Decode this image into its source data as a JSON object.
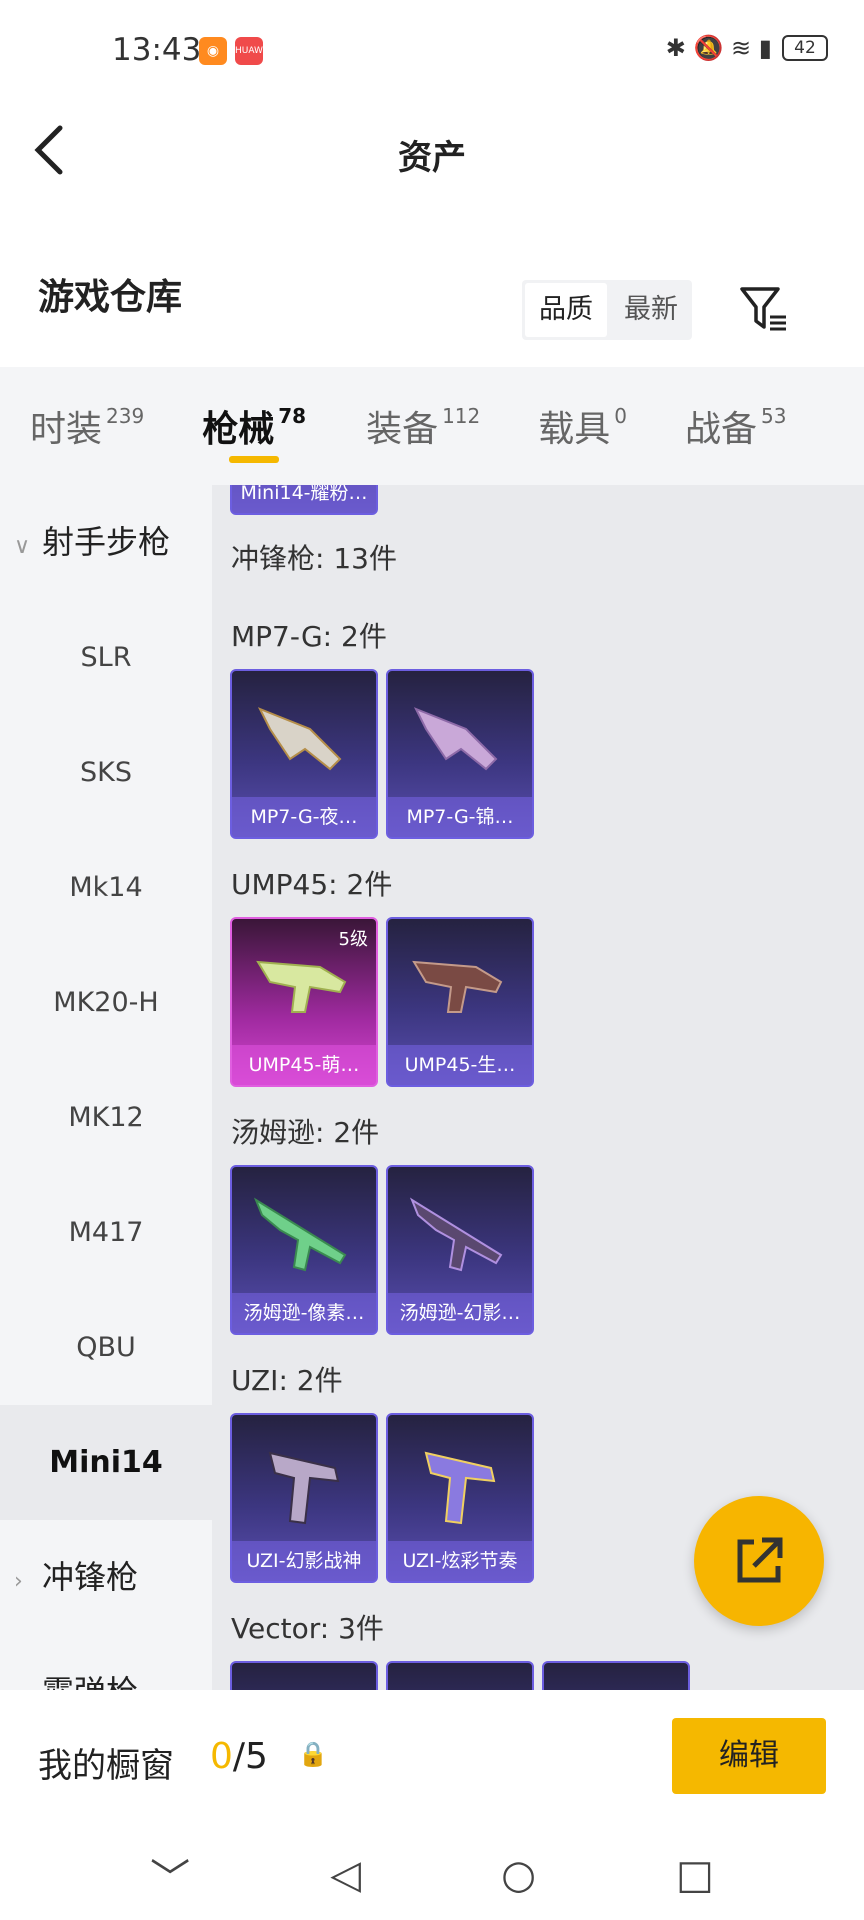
{
  "status": {
    "time": "13:43",
    "app1": "◉",
    "app2": "HUAWEI",
    "battery": "42",
    "icons": "✱ 🔕 ≋ ▮"
  },
  "header": {
    "title": "资产",
    "warehouse": "游戏仓库",
    "sort": [
      "品质",
      "最新"
    ]
  },
  "tabs": [
    {
      "label": "时装",
      "count": "239"
    },
    {
      "label": "枪械",
      "count": "78"
    },
    {
      "label": "装备",
      "count": "112"
    },
    {
      "label": "载具",
      "count": "0"
    },
    {
      "label": "战备",
      "count": "53"
    }
  ],
  "sidebar": {
    "group1": "射手步枪",
    "items": [
      "SLR",
      "SKS",
      "Mk14",
      "MK20-H",
      "MK12",
      "M417",
      "QBU",
      "Mini14"
    ],
    "group2": "冲锋枪",
    "group3": "霰弹枪"
  },
  "main": {
    "top_card": "Mini14-耀粉…",
    "section": "冲锋枪: 13件",
    "groups": [
      {
        "title": "MP7-G: 2件",
        "cards": [
          "MP7-G-夜…",
          "MP7-G-锦…"
        ]
      },
      {
        "title": "UMP45: 2件",
        "cards": [
          "UMP45-萌…",
          "UMP45-生…"
        ],
        "level": "5级"
      },
      {
        "title": "汤姆逊: 2件",
        "cards": [
          "汤姆逊-像素…",
          "汤姆逊-幻影…"
        ]
      },
      {
        "title": "UZI: 2件",
        "cards": [
          "UZI-幻影战神",
          "UZI-炫彩节奏"
        ]
      },
      {
        "title": "Vector: 3件",
        "cards": []
      }
    ]
  },
  "bottom": {
    "showcase": "我的橱窗",
    "count_current": "0",
    "count_total": "/5",
    "edit": "编辑"
  },
  "nav": {
    "back": "﹀",
    "triangle": "◁",
    "circle": "○",
    "square": "□"
  }
}
